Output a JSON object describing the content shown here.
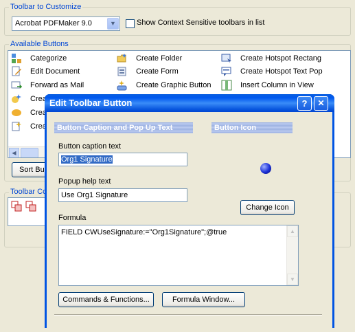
{
  "toolbar_group": {
    "title": "Toolbar to Customize",
    "combo_value": "Acrobat PDFMaker 9.0",
    "checkbox_label": "Show Context Sensitive toolbars in list"
  },
  "available": {
    "title": "Available Buttons",
    "col1": [
      "Categorize",
      "Edit Document",
      "Forward as Mail",
      "Crea",
      "Crea",
      "Crea"
    ],
    "col2": [
      "Create Folder",
      "Create Form",
      "Create Graphic Button"
    ],
    "col3": [
      "Create Hotspot Rectang",
      "Create Hotspot Text Pop",
      "Insert Column in View"
    ],
    "sort_button": "Sort Bu"
  },
  "toolbar_contents": {
    "title": "Toolbar Co"
  },
  "dialog": {
    "title": "Edit Toolbar Button",
    "help_btn": "?",
    "close_btn": "✕",
    "section_caption": "Button Caption and Pop Up Text",
    "section_icon": "Button Icon",
    "caption_label": "Button caption text",
    "caption_value": "Org1 Signature",
    "popup_label": "Popup help text",
    "popup_value": "Use Org1 Signature",
    "change_icon": "Change Icon",
    "formula_label": "Formula",
    "formula_value": "FIELD CWUseSignature:=\"Org1Signature\";@true",
    "commands_btn": "Commands & Functions...",
    "formula_window_btn": "Formula Window..."
  },
  "colors": {
    "accent_title": "#0046d5",
    "dialog_frame": "#0054e3",
    "selection": "#316ac5",
    "icon_sphere": "#1a2fd6"
  }
}
